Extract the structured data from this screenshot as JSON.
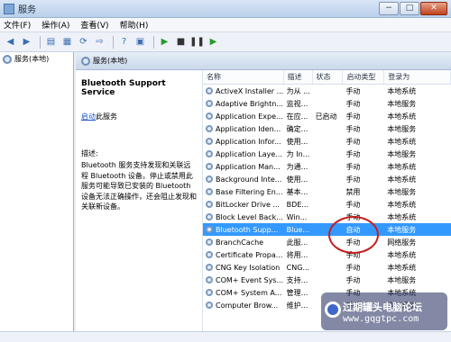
{
  "window": {
    "title": "服务",
    "controls": [
      "−",
      "□",
      "✕"
    ]
  },
  "menu": [
    "文件(F)",
    "操作(A)",
    "查看(V)",
    "帮助(H)"
  ],
  "tree": {
    "root_label": "服务(本地)"
  },
  "pane_header": "服务(本地)",
  "details": {
    "service_name": "Bluetooth Support Service",
    "start_link": "启动",
    "start_suffix": "此服务",
    "description_label": "描述:",
    "description_text": "Bluetooth 服务支持发现和关联远程 Bluetooth 设备。停止或禁用此服务可能导致已安装的 Bluetooth 设备无法正确操作，还会阻止发现和关联新设备。"
  },
  "list": {
    "sort_indicator": "^",
    "columns": [
      "名称",
      "描述",
      "状态",
      "启动类型",
      "登录为"
    ],
    "rows": [
      {
        "name": "ActiveX Installer ...",
        "desc": "为从 ...",
        "status": "",
        "start": "手动",
        "logon": "本地系统",
        "selected": false
      },
      {
        "name": "Adaptive Brightn...",
        "desc": "监视...",
        "status": "",
        "start": "手动",
        "logon": "本地服务",
        "selected": false
      },
      {
        "name": "Application Expe...",
        "desc": "在应...",
        "status": "已启动",
        "start": "手动",
        "logon": "本地系统",
        "selected": false
      },
      {
        "name": "Application Iden...",
        "desc": "确定...",
        "status": "",
        "start": "手动",
        "logon": "本地服务",
        "selected": false
      },
      {
        "name": "Application Infor...",
        "desc": "使用...",
        "status": "",
        "start": "手动",
        "logon": "本地系统",
        "selected": false
      },
      {
        "name": "Application Laye...",
        "desc": "为 In...",
        "status": "",
        "start": "手动",
        "logon": "本地服务",
        "selected": false
      },
      {
        "name": "Application Man...",
        "desc": "为通...",
        "status": "",
        "start": "手动",
        "logon": "本地系统",
        "selected": false
      },
      {
        "name": "Background Inte...",
        "desc": "使用...",
        "status": "",
        "start": "手动",
        "logon": "本地系统",
        "selected": false
      },
      {
        "name": "Base Filtering En...",
        "desc": "基本...",
        "status": "",
        "start": "禁用",
        "logon": "本地服务",
        "selected": false
      },
      {
        "name": "BitLocker Drive ...",
        "desc": "BDE...",
        "status": "",
        "start": "手动",
        "logon": "本地系统",
        "selected": false
      },
      {
        "name": "Block Level Back...",
        "desc": "Win...",
        "status": "",
        "start": "手动",
        "logon": "本地系统",
        "selected": false
      },
      {
        "name": "Bluetooth Supp...",
        "desc": "Blue...",
        "status": "",
        "start": "自动",
        "logon": "本地服务",
        "selected": true
      },
      {
        "name": "BranchCache",
        "desc": "此服...",
        "status": "",
        "start": "手动",
        "logon": "网络服务",
        "selected": false
      },
      {
        "name": "Certificate Propa...",
        "desc": "将用...",
        "status": "",
        "start": "手动",
        "logon": "本地系统",
        "selected": false
      },
      {
        "name": "CNG Key Isolation",
        "desc": "CNG...",
        "status": "",
        "start": "手动",
        "logon": "本地系统",
        "selected": false
      },
      {
        "name": "COM+ Event Sys...",
        "desc": "支持...",
        "status": "",
        "start": "手动",
        "logon": "本地服务",
        "selected": false
      },
      {
        "name": "COM+ System A...",
        "desc": "管理...",
        "status": "",
        "start": "手动",
        "logon": "本地系统",
        "selected": false
      },
      {
        "name": "Computer Brow...",
        "desc": "维护...",
        "status": "",
        "start": "手动",
        "logon": "本地系统",
        "selected": false
      }
    ]
  },
  "watermark": {
    "line1": "过期罐头电脑论坛",
    "line2": "www.gqgtpc.com"
  }
}
